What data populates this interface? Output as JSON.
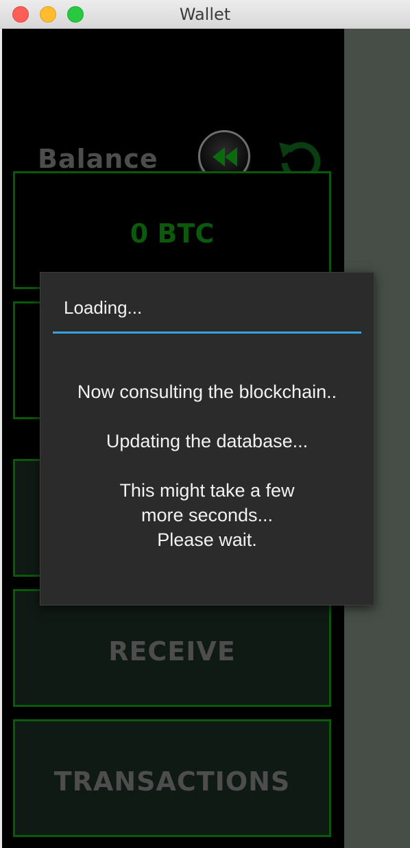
{
  "window": {
    "title": "Wallet"
  },
  "balance": {
    "label": "Balance",
    "amount": "0 BTC"
  },
  "icons": {
    "rewind": "rewind-icon",
    "refresh": "refresh-icon"
  },
  "buttons": {
    "receive": "RECEIVE",
    "transactions": "TRANSACTIONS"
  },
  "dialog": {
    "title": "Loading...",
    "line1": "Now consulting the blockchain..",
    "line2": "Updating the database...",
    "line3a": "This might take a few",
    "line3b": "more seconds...",
    "line3c": "Please wait."
  },
  "colors": {
    "accent_green": "#0b5a0b",
    "dialog_rule": "#33a4dc",
    "side_pane": "#464e47"
  }
}
